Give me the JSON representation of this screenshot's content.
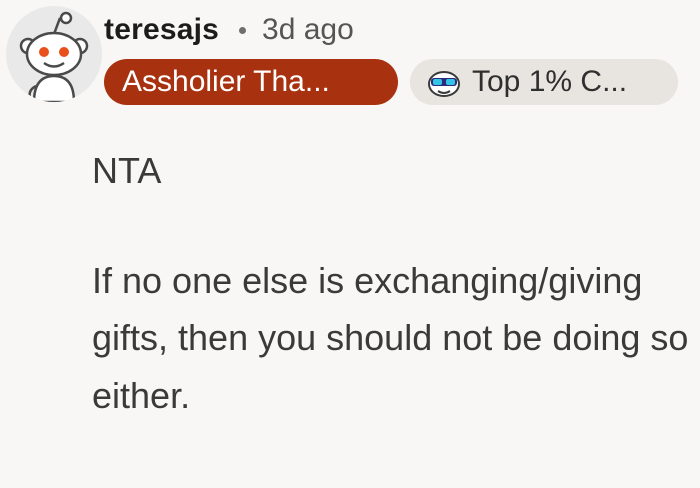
{
  "comment": {
    "author": "teresajs",
    "separator": "•",
    "timestamp": "3d ago",
    "author_flair": "Assholier Tha...",
    "badge_flair": "Top 1% C...",
    "badge_icon": "sunglasses-snoo-icon",
    "avatar_icon": "snoo-avatar-icon",
    "body": [
      "NTA",
      "If no one else is exchanging/giving gifts, then you should not be doing so either."
    ]
  },
  "colors": {
    "background": "#f9f7f5",
    "author_flair_bg": "#a8320f",
    "badge_flair_bg": "#e8e4df",
    "avatar_accent": "#e8511c"
  }
}
